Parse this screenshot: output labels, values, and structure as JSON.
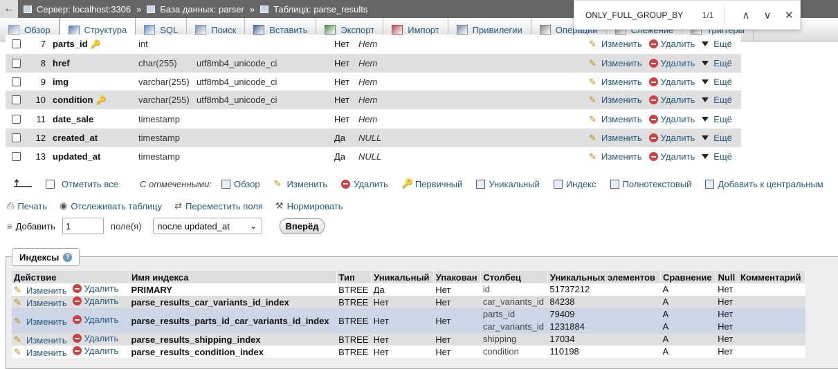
{
  "breadcrumb": {
    "back": "←",
    "server": "Сервер: localhost:3306",
    "database": "База данных: parser",
    "table": "Таблица: parse_results",
    "separator": "»"
  },
  "findbar": {
    "query": "ONLY_FULL_GROUP_BY",
    "count": "1/1",
    "prev": "∧",
    "next": "∨",
    "close": "✕"
  },
  "tabs": [
    {
      "label": "Обзор",
      "icon": "browse-icon",
      "color": "#8aa1be"
    },
    {
      "label": "Структура",
      "icon": "structure-icon",
      "color": "#5a7bb0"
    },
    {
      "label": "SQL",
      "icon": "sql-icon",
      "color": "#6a8ec0"
    },
    {
      "label": "Поиск",
      "icon": "search-icon",
      "color": "#8090a8"
    },
    {
      "label": "Вставить",
      "icon": "insert-icon",
      "color": "#4a6a98"
    },
    {
      "label": "Экспорт",
      "icon": "export-icon",
      "color": "#5a8a5a"
    },
    {
      "label": "Импорт",
      "icon": "import-icon",
      "color": "#b05050"
    },
    {
      "label": "Привилегии",
      "icon": "privileges-icon",
      "color": "#7a8aa0"
    },
    {
      "label": "Операции",
      "icon": "operations-icon",
      "color": "#888888"
    },
    {
      "label": "Слежение",
      "icon": "tracking-icon",
      "color": "#888888"
    },
    {
      "label": "Триггеры",
      "icon": "triggers-icon",
      "color": "#888888"
    }
  ],
  "structure": {
    "edit_label": "Изменить",
    "delete_label": "Удалить",
    "more_label": "Ещё",
    "rows": [
      {
        "num": "7",
        "name": "parts_id",
        "key": true,
        "type": "int",
        "collation": "",
        "null": "Нет",
        "default": "Нет"
      },
      {
        "num": "8",
        "name": "href",
        "key": false,
        "type": "char(255)",
        "collation": "utf8mb4_unicode_ci",
        "null": "Нет",
        "default": "Нет"
      },
      {
        "num": "9",
        "name": "img",
        "key": false,
        "type": "varchar(255)",
        "collation": "utf8mb4_unicode_ci",
        "null": "Нет",
        "default": "Нет"
      },
      {
        "num": "10",
        "name": "condition",
        "key": true,
        "type": "varchar(255)",
        "collation": "utf8mb4_unicode_ci",
        "null": "Нет",
        "default": "Нет"
      },
      {
        "num": "11",
        "name": "date_sale",
        "key": false,
        "type": "timestamp",
        "collation": "",
        "null": "Нет",
        "default": "Нет"
      },
      {
        "num": "12",
        "name": "created_at",
        "key": false,
        "type": "timestamp",
        "collation": "",
        "null": "Да",
        "default": "NULL"
      },
      {
        "num": "13",
        "name": "updated_at",
        "key": false,
        "type": "timestamp",
        "collation": "",
        "null": "Да",
        "default": "NULL"
      }
    ]
  },
  "bulk": {
    "select_all": "Отметить все",
    "with_selected": "С отмеченными:",
    "actions": [
      {
        "label": "Обзор",
        "icon": "browse-icon"
      },
      {
        "label": "Изменить",
        "icon": "pencil-icon"
      },
      {
        "label": "Удалить",
        "icon": "delete-icon"
      },
      {
        "label": "Первичный",
        "icon": "primary-key-icon"
      },
      {
        "label": "Уникальный",
        "icon": "unique-icon"
      },
      {
        "label": "Индекс",
        "icon": "index-icon"
      },
      {
        "label": "Полнотекстовый",
        "icon": "fulltext-icon"
      },
      {
        "label": "Добавить к центральным",
        "icon": "central-columns-icon"
      }
    ]
  },
  "tools": [
    {
      "label": "Печать",
      "icon": "print-icon"
    },
    {
      "label": "Отслеживать таблицу",
      "icon": "eye-icon"
    },
    {
      "label": "Переместить поля",
      "icon": "move-columns-icon"
    },
    {
      "label": "Нормировать",
      "icon": "normalize-icon"
    }
  ],
  "add": {
    "label": "Добавить",
    "value": "1",
    "fields_label": "поле(я)",
    "position": "после updated_at",
    "go": "Вперёд"
  },
  "indexes": {
    "legend": "Индексы",
    "headers": [
      "Действие",
      "Имя индекса",
      "Тип",
      "Уникальный",
      "Упакован",
      "Столбец",
      "Уникальных элементов",
      "Сравнение",
      "Null",
      "Комментарий"
    ],
    "edit_label": "Изменить",
    "delete_label": "Удалить",
    "rows": [
      {
        "name": "PRIMARY",
        "type": "BTREE",
        "unique": "Да",
        "packed": "Нет",
        "columns": [
          {
            "col": "id",
            "card": "51737212",
            "coll": "A",
            "null": "Нет"
          }
        ]
      },
      {
        "name": "parse_results_car_variants_id_index",
        "type": "BTREE",
        "unique": "Нет",
        "packed": "Нет",
        "columns": [
          {
            "col": "car_variants_id",
            "card": "84238",
            "coll": "A",
            "null": "Нет"
          }
        ]
      },
      {
        "name": "parse_results_parts_id_car_variants_id_index",
        "type": "BTREE",
        "unique": "Нет",
        "packed": "Нет",
        "columns": [
          {
            "col": "parts_id",
            "card": "79409",
            "coll": "A",
            "null": "Нет"
          },
          {
            "col": "car_variants_id",
            "card": "1231884",
            "coll": "A",
            "null": "Нет"
          }
        ]
      },
      {
        "name": "parse_results_shipping_index",
        "type": "BTREE",
        "unique": "Нет",
        "packed": "Нет",
        "columns": [
          {
            "col": "shipping",
            "card": "17034",
            "coll": "A",
            "null": "Нет"
          }
        ]
      },
      {
        "name": "parse_results_condition_index",
        "type": "BTREE",
        "unique": "Нет",
        "packed": "Нет",
        "columns": [
          {
            "col": "condition",
            "card": "110198",
            "coll": "A",
            "null": "Нет"
          }
        ]
      }
    ]
  }
}
